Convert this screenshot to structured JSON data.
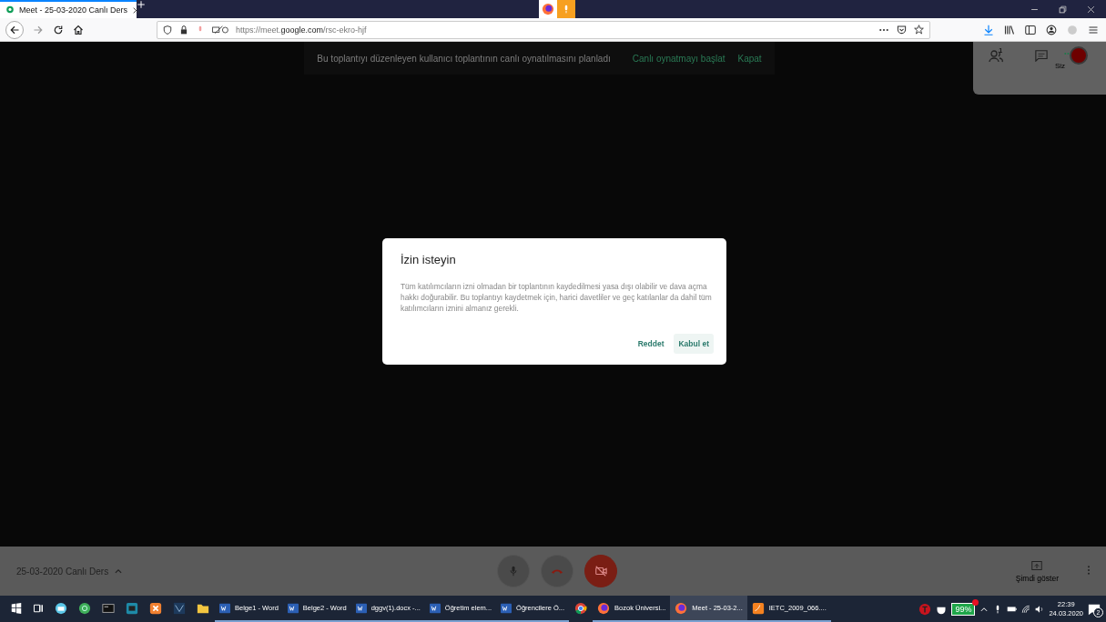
{
  "browser": {
    "tabs": [
      {
        "title": "Meet - 25-03-2020 Canlı Ders",
        "selected": true
      }
    ],
    "url": "https://meet.**google.com**/rsc-ekro-hjf"
  },
  "meet": {
    "banner": {
      "text": "Bu toplantıyı düzenleyen kullanıcı toplantının canlı oynatılmasını planladı",
      "actions": [
        "Canlı oynatmayı başlat",
        "Kapat"
      ]
    },
    "top_panel": {
      "participant_count": "1",
      "self_label": "Siz"
    },
    "dialog": {
      "title": "İzin isteyin",
      "body": "Tüm katılımcıların izni olmadan bir toplantının kaydedilmesi yasa dışı olabilir ve dava açma hakkı doğurabilir. Bu toplantıyı kaydetmek için, harici davetliler ve geç katılanlar da dahil tüm katılımcıların iznini almanız gerekli.",
      "buttons": [
        {
          "label": "Reddet",
          "kind": "text"
        },
        {
          "label": "Kabul et",
          "kind": "tonal"
        }
      ]
    },
    "bottom_bar": {
      "meeting_name": "25-03-2020 Canlı Ders",
      "present_label": "Şimdi göster"
    }
  },
  "taskbar": {
    "items": [
      {
        "kind": "start"
      },
      {
        "kind": "taskview"
      },
      {
        "kind": "mail"
      },
      {
        "kind": "globe"
      },
      {
        "kind": "terminal"
      },
      {
        "kind": "ide"
      },
      {
        "kind": "xampp"
      },
      {
        "kind": "tool"
      },
      {
        "kind": "folder"
      },
      {
        "kind": "word",
        "label": "Belge1 - Word",
        "active": false
      },
      {
        "kind": "word",
        "label": "Belge2 - Word",
        "active": false
      },
      {
        "kind": "word",
        "label": "dggv(1).docx -...",
        "active": false
      },
      {
        "kind": "word",
        "label": "Öğretim elem...",
        "active": false
      },
      {
        "kind": "word",
        "label": "Öğrencilere Ö...",
        "active": false
      },
      {
        "kind": "chrome"
      },
      {
        "kind": "firefox",
        "label": "Bozok Üniversi...",
        "active": false
      },
      {
        "kind": "firefox",
        "label": "Meet - 25-03-2...",
        "active": true
      },
      {
        "kind": "pdf",
        "label": "IETC_2009_066....",
        "active": false
      }
    ],
    "battery": "99%",
    "time": "22:39",
    "date": "24.03.2020",
    "notifications": "2"
  }
}
